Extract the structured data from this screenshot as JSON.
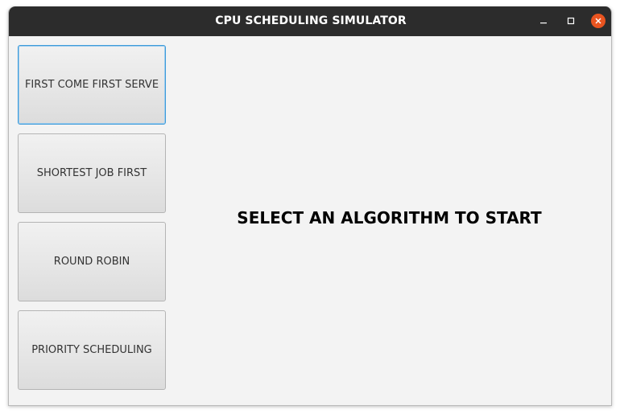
{
  "window": {
    "title": "CPU SCHEDULING SIMULATOR",
    "controls": {
      "minimize_icon": "minimize-icon",
      "maximize_icon": "maximize-icon",
      "close_icon": "close-icon"
    }
  },
  "sidebar": {
    "buttons": [
      {
        "label": "FIRST COME FIRST SERVE"
      },
      {
        "label": "SHORTEST JOB FIRST"
      },
      {
        "label": "ROUND ROBIN"
      },
      {
        "label": "PRIORITY SCHEDULING"
      }
    ]
  },
  "main": {
    "prompt": "SELECT AN ALGORITHM TO START"
  },
  "colors": {
    "titlebar": "#2c2c2c",
    "close_button": "#e95420",
    "focus_ring": "#3d9bd9",
    "background": "#f3f3f3"
  }
}
